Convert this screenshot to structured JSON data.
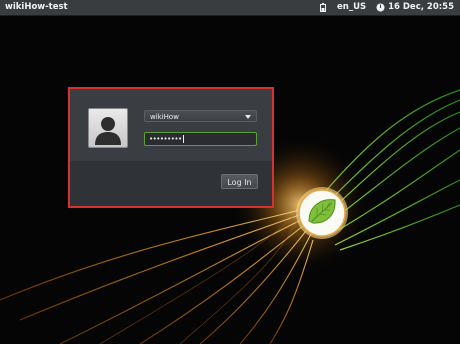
{
  "topbar": {
    "hostname": "wikiHow-test",
    "keyboard_layout": "en_US",
    "datetime": "16 Dec, 20:55",
    "icons": [
      "battery-icon",
      "power-icon"
    ]
  },
  "login": {
    "username": "wikiHow",
    "password_mask": "•••••••••",
    "login_button": "Log In"
  },
  "colors": {
    "highlight_border": "#d63131",
    "password_focus": "#5ba03a",
    "topbar": "#3a3d40"
  }
}
